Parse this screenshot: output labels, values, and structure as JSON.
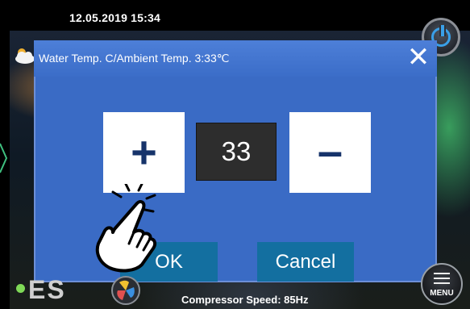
{
  "status_bar": {
    "datetime": "12.05.2019  15:34"
  },
  "dialog": {
    "title": "Water Temp. C/Ambient Temp. 3:33℃",
    "close_icon": "close-icon",
    "plus_label": "+",
    "value": "33",
    "minus_label": "–",
    "ok_label": "OK",
    "cancel_label": "Cancel"
  },
  "footer": {
    "logo_text": "ES",
    "compressor_speed": "Compressor Speed: 85Hz",
    "menu_label": "MENU"
  },
  "icons": [
    "power-icon",
    "menu-icon",
    "cloud-sun-icon",
    "fan-icon",
    "hand-pointer-icon",
    "left-arrow-icon"
  ],
  "colors": {
    "dialog_bg": "#3a6bc5",
    "button_blue": "#136fa0",
    "value_bg": "#2d2d2d",
    "power_accent": "#3aa0e8",
    "status_green": "#7ed957"
  }
}
